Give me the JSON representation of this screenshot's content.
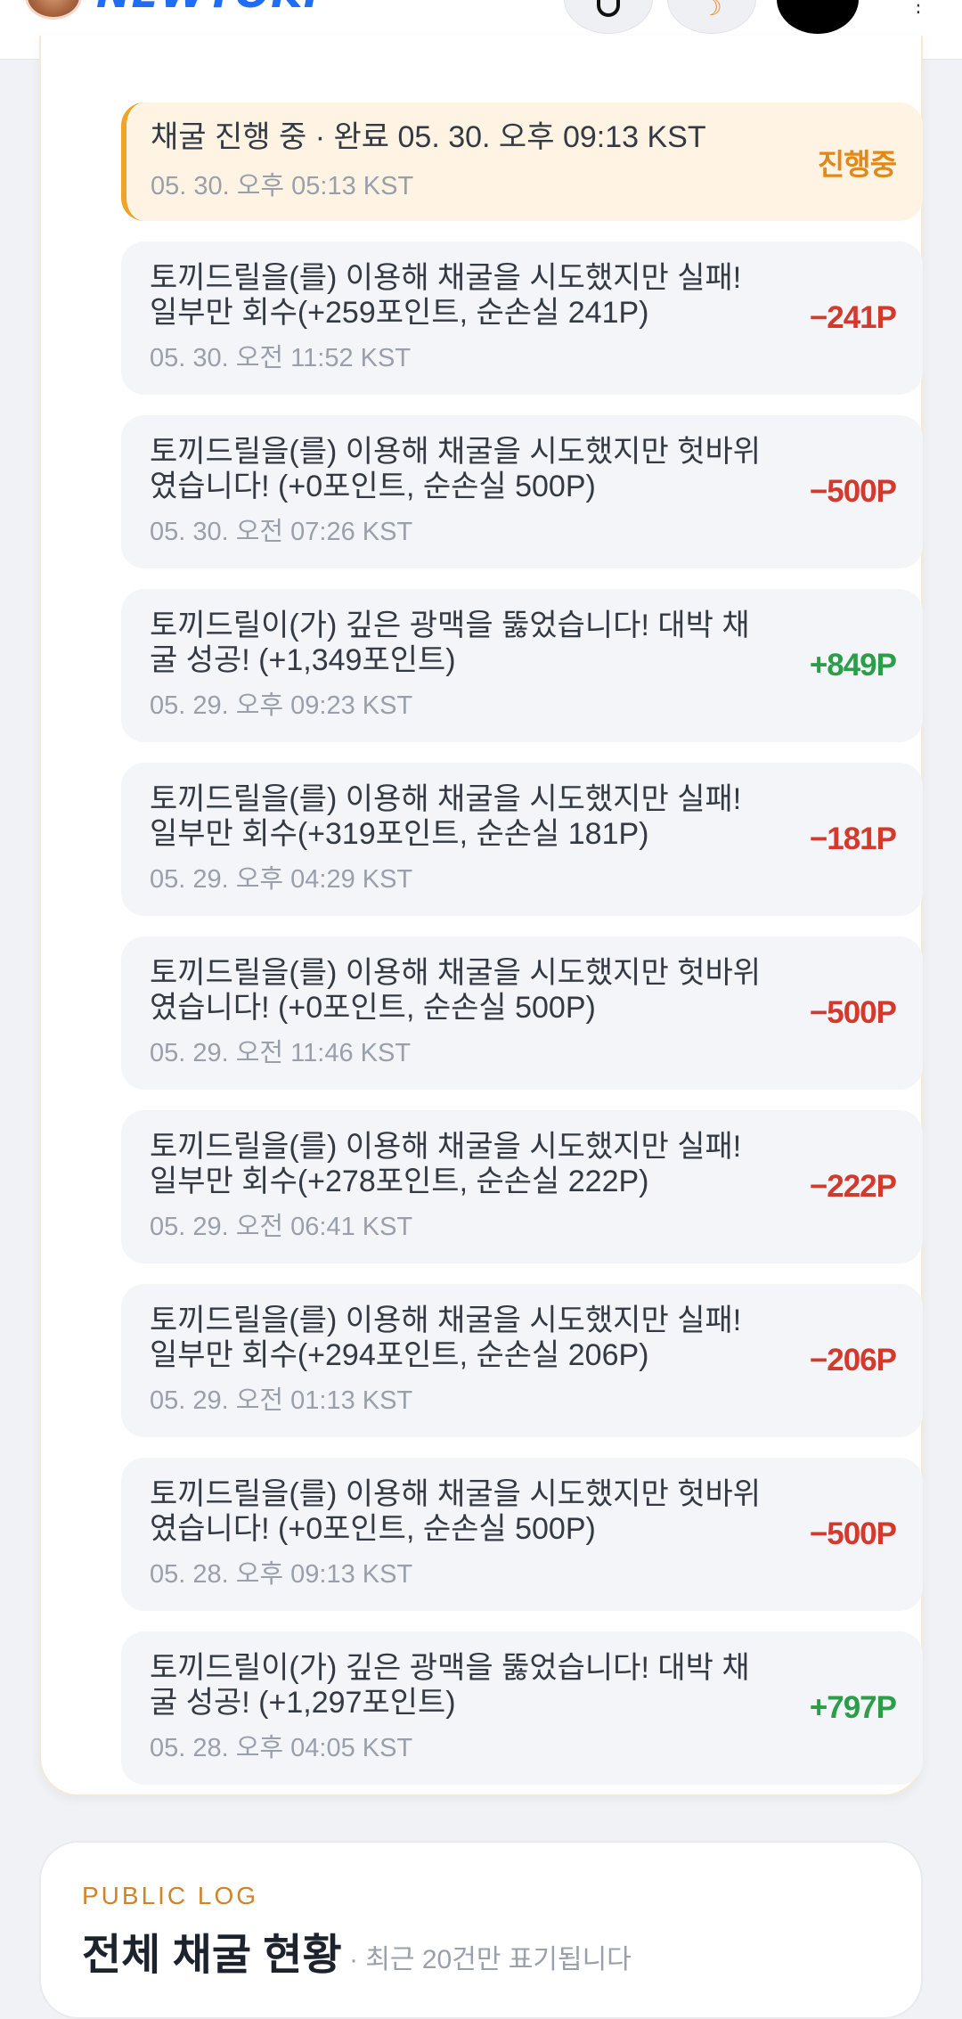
{
  "header": {
    "logo_text": "NEWTOKI",
    "icons": [
      "search-icon",
      "moon-icon",
      "profile-icon",
      "more-icon"
    ]
  },
  "colors": {
    "accent": "#f0a229",
    "negative": "#d23a2e",
    "positive": "#2c9d49",
    "progress": "#e0891a"
  },
  "mining_log": {
    "active": {
      "title": "채굴 진행 중 · 완료 05. 30. 오후 09:13 KST",
      "time": "05. 30. 오후 05:13 KST",
      "status": "진행중"
    },
    "items": [
      {
        "text": "토끼드릴을(를) 이용해 채굴을 시도했지만 실패! 일부만 회수(+259포인트, 순손실 241P)",
        "time": "05. 30. 오전 11:52 KST",
        "amount": "−241P",
        "kind": "neg"
      },
      {
        "text": "토끼드릴을(를) 이용해 채굴을 시도했지만 헛바위였습니다! (+0포인트, 순손실 500P)",
        "time": "05. 30. 오전 07:26 KST",
        "amount": "−500P",
        "kind": "neg"
      },
      {
        "text": "토끼드릴이(가) 깊은 광맥을 뚫었습니다! 대박 채굴 성공! (+1,349포인트)",
        "time": "05. 29. 오후 09:23 KST",
        "amount": "+849P",
        "kind": "pos"
      },
      {
        "text": "토끼드릴을(를) 이용해 채굴을 시도했지만 실패! 일부만 회수(+319포인트, 순손실 181P)",
        "time": "05. 29. 오후 04:29 KST",
        "amount": "−181P",
        "kind": "neg"
      },
      {
        "text": "토끼드릴을(를) 이용해 채굴을 시도했지만 헛바위였습니다! (+0포인트, 순손실 500P)",
        "time": "05. 29. 오전 11:46 KST",
        "amount": "−500P",
        "kind": "neg"
      },
      {
        "text": "토끼드릴을(를) 이용해 채굴을 시도했지만 실패! 일부만 회수(+278포인트, 순손실 222P)",
        "time": "05. 29. 오전 06:41 KST",
        "amount": "−222P",
        "kind": "neg"
      },
      {
        "text": "토끼드릴을(를) 이용해 채굴을 시도했지만 실패! 일부만 회수(+294포인트, 순손실 206P)",
        "time": "05. 29. 오전 01:13 KST",
        "amount": "−206P",
        "kind": "neg"
      },
      {
        "text": "토끼드릴을(를) 이용해 채굴을 시도했지만 헛바위였습니다! (+0포인트, 순손실 500P)",
        "time": "05. 28. 오후 09:13 KST",
        "amount": "−500P",
        "kind": "neg"
      },
      {
        "text": "토끼드릴이(가) 깊은 광맥을 뚫었습니다! 대박 채굴 성공! (+1,297포인트)",
        "time": "05. 28. 오후 04:05 KST",
        "amount": "+797P",
        "kind": "pos"
      }
    ]
  },
  "public_log": {
    "eyebrow": "PUBLIC LOG",
    "title": "전체 채굴 현황",
    "subtitle": "· 최근 20건만 표기됩니다"
  }
}
